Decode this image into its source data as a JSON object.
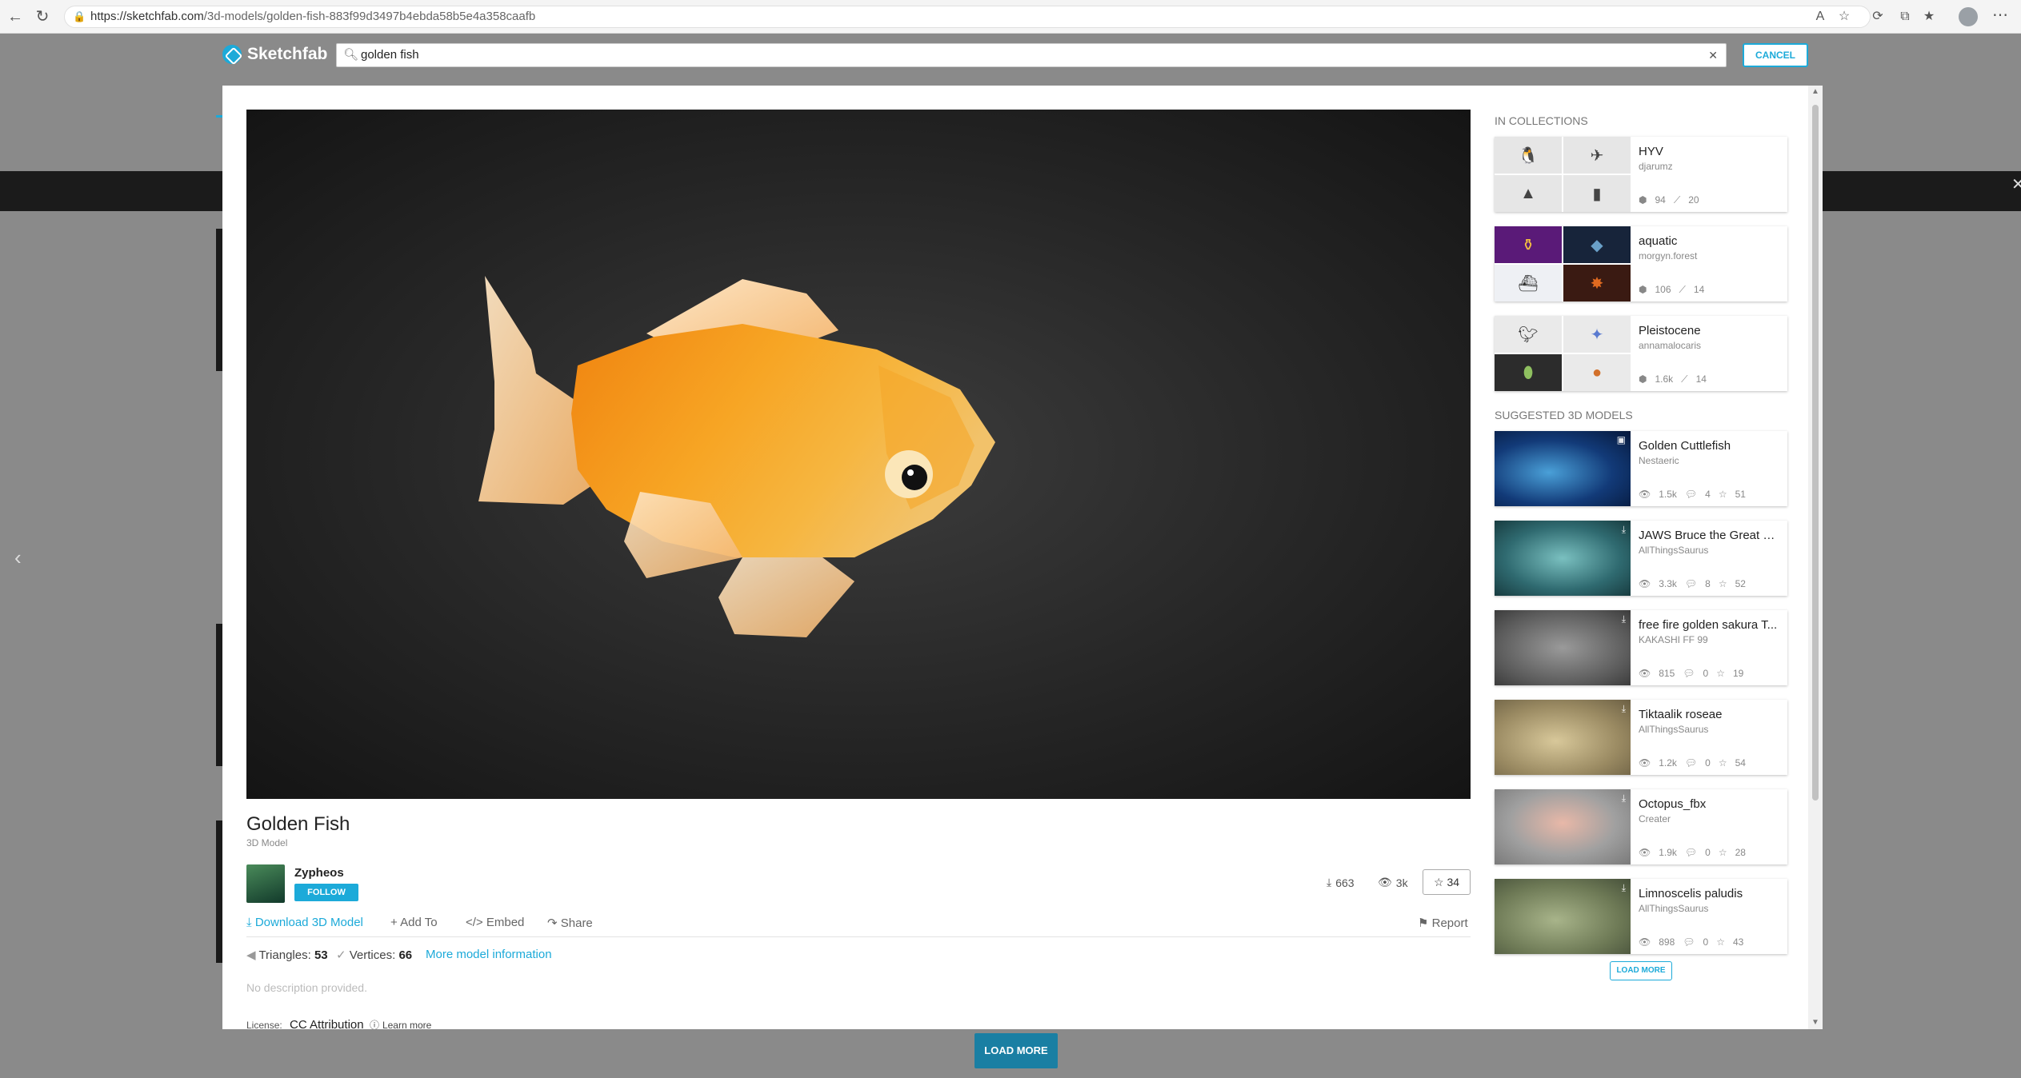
{
  "browser": {
    "url_host": "https://sketchfab.com",
    "url_path": "/3d-models/golden-fish-883f99d3497b4ebda58b5e4a358caafb",
    "icons": [
      "back-icon",
      "refresh-icon",
      "lock-icon",
      "read-aloud-icon",
      "favorite-icon",
      "extensions-icon",
      "collections-icon",
      "favorites-bar-icon",
      "profile-icon"
    ]
  },
  "search": {
    "brand": "Sketchfab",
    "query": "golden fish",
    "cancel_label": "CANCEL"
  },
  "model": {
    "title": "Golden Fish",
    "subtitle": "3D Model",
    "author": "Zypheos",
    "follow_label": "FOLLOW",
    "downloads": "663",
    "views": "3k",
    "likes": "34",
    "actions": {
      "download": "Download 3D Model",
      "add_to": "Add To",
      "embed": "Embed",
      "share": "Share",
      "report": "Report"
    },
    "triangles_label": "Triangles:",
    "triangles": "53",
    "vertices_label": "Vertices:",
    "vertices": "66",
    "more_info": "More model information",
    "description": "No description provided.",
    "license_label": "License:",
    "license_name": "CC Attribution",
    "learn_more": "Learn more"
  },
  "sidebar": {
    "collections_title": "IN COLLECTIONS",
    "collections": [
      {
        "title": "HYV",
        "user": "djarumz",
        "models": "94",
        "likes": "20"
      },
      {
        "title": "aquatic",
        "user": "morgyn.forest",
        "models": "106",
        "likes": "14"
      },
      {
        "title": "Pleistocene",
        "user": "annamalocaris",
        "models": "1.6k",
        "likes": "14"
      }
    ],
    "suggested_title": "SUGGESTED 3D MODELS",
    "suggested": [
      {
        "title": "Golden Cuttlefish",
        "user": "Nestaeric",
        "views": "1.5k",
        "comments": "4",
        "likes": "51"
      },
      {
        "title": "JAWS Bruce the Great W...",
        "user": "AllThingsSaurus",
        "views": "3.3k",
        "comments": "8",
        "likes": "52"
      },
      {
        "title": "free fire golden sakura T...",
        "user": "KAKASHI FF 99",
        "views": "815",
        "comments": "0",
        "likes": "19"
      },
      {
        "title": "Tiktaalik roseae",
        "user": "AllThingsSaurus",
        "views": "1.2k",
        "comments": "0",
        "likes": "54"
      },
      {
        "title": "Octopus_fbx",
        "user": "Creater",
        "views": "1.9k",
        "comments": "0",
        "likes": "28"
      },
      {
        "title": "Limnoscelis paludis",
        "user": "AllThingsSaurus",
        "views": "898",
        "comments": "0",
        "likes": "43"
      }
    ],
    "load_more_label": "LOAD MORE"
  },
  "page": {
    "load_more_label": "LOAD MORE"
  },
  "colors": {
    "accent": "#1caad9",
    "fish_orange": "#f59a1c"
  }
}
